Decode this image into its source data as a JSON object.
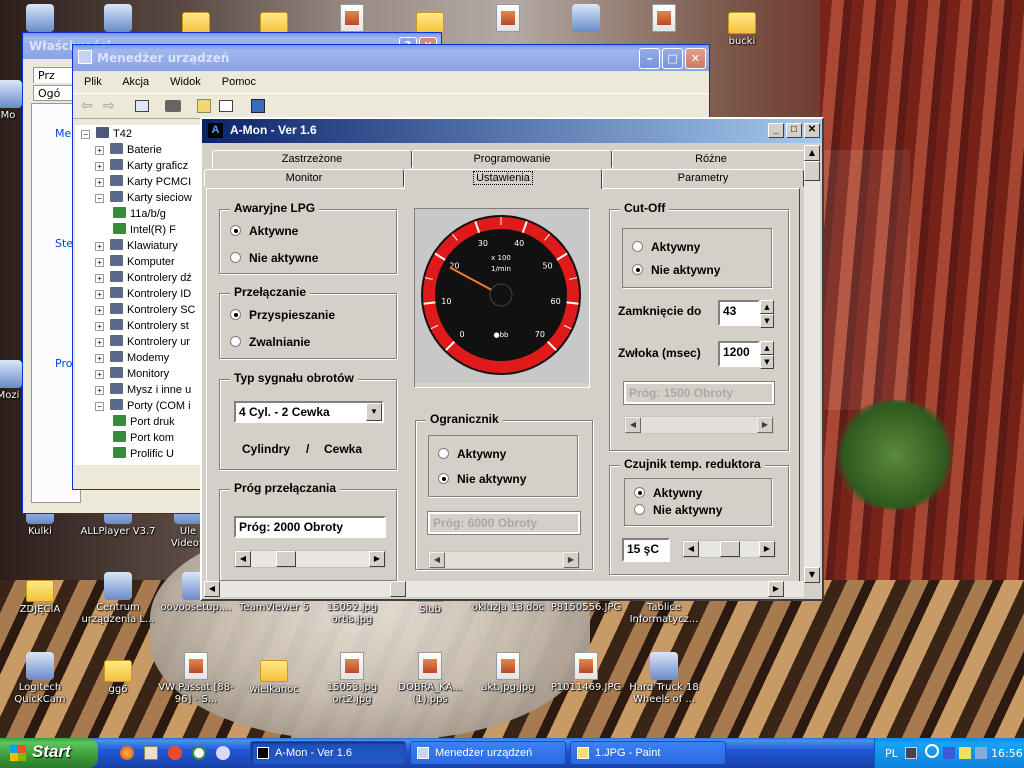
{
  "desktop": {
    "icons": [
      {
        "label": "Mo",
        "kind": "computer"
      },
      {
        "label": "",
        "kind": "app"
      },
      {
        "label": "",
        "kind": "folder"
      },
      {
        "label": "",
        "kind": "folder"
      },
      {
        "label": "",
        "kind": "image"
      },
      {
        "label": "",
        "kind": "folder"
      },
      {
        "label": "",
        "kind": "image"
      },
      {
        "label": "",
        "kind": "app"
      },
      {
        "label": "",
        "kind": "image"
      },
      {
        "label": "bucki",
        "kind": "folder"
      },
      {
        "label": "Kulki",
        "kind": "app"
      },
      {
        "label": "ALLPlayer V3.7",
        "kind": "app"
      },
      {
        "label": "Ule\nVideoS",
        "kind": "app"
      },
      {
        "label": "ZDJĘCIA",
        "kind": "folder"
      },
      {
        "label": "Centrum urządzenia L...",
        "kind": "app"
      },
      {
        "label": "oovoosetup....",
        "kind": "app"
      },
      {
        "label": "TeamViewer 5",
        "kind": "app"
      },
      {
        "label": "15052.jpg ortis.jpg",
        "kind": "image"
      },
      {
        "label": "Slub",
        "kind": "folder"
      },
      {
        "label": "okluzja 13.doc",
        "kind": "doc"
      },
      {
        "label": "P8150556.JPG",
        "kind": "image"
      },
      {
        "label": "Tablice Informatycz...",
        "kind": "app"
      },
      {
        "label": "Logitech QuickCam",
        "kind": "app"
      },
      {
        "label": "gg6",
        "kind": "folder"
      },
      {
        "label": "VW Passat [88-96] - S...",
        "kind": "pdf"
      },
      {
        "label": "wielkanoc",
        "kind": "folder"
      },
      {
        "label": "15053.jpg ort2.jpg",
        "kind": "image"
      },
      {
        "label": "DOBRA_KA... (1).pps",
        "kind": "pps"
      },
      {
        "label": "akt.jpg.jpg",
        "kind": "image"
      },
      {
        "label": "P1011469.JPG",
        "kind": "image"
      },
      {
        "label": "Hard Truck 18 Wheels of ...",
        "kind": "app"
      },
      {
        "label": "Mo",
        "kind": "app"
      },
      {
        "label": "Mozi",
        "kind": "app"
      }
    ]
  },
  "props_window": {
    "title": "Właściwości",
    "tab1": "Prz",
    "tab2": "Ogó",
    "labels": [
      "Me",
      "Ste",
      "Pro"
    ]
  },
  "device_manager": {
    "title": "Menedżer urządzeń",
    "menu": [
      "Plik",
      "Akcja",
      "Widok",
      "Pomoc"
    ],
    "root": "T42",
    "items": [
      {
        "label": "Baterie",
        "expanded": false,
        "indent": 1
      },
      {
        "label": "Karty graficz",
        "expanded": false,
        "indent": 1
      },
      {
        "label": "Karty PCMCI",
        "expanded": false,
        "indent": 1
      },
      {
        "label": "Karty sieciow",
        "expanded": true,
        "indent": 1
      },
      {
        "label": "11a/b/g",
        "expanded": null,
        "indent": 2
      },
      {
        "label": "Intel(R) F",
        "expanded": null,
        "indent": 2
      },
      {
        "label": "Klawiatury",
        "expanded": false,
        "indent": 1
      },
      {
        "label": "Komputer",
        "expanded": false,
        "indent": 1
      },
      {
        "label": "Kontrolery dź",
        "expanded": false,
        "indent": 1
      },
      {
        "label": "Kontrolery ID",
        "expanded": false,
        "indent": 1
      },
      {
        "label": "Kontrolery SC",
        "expanded": false,
        "indent": 1
      },
      {
        "label": "Kontrolery st",
        "expanded": false,
        "indent": 1
      },
      {
        "label": "Kontrolery ur",
        "expanded": false,
        "indent": 1
      },
      {
        "label": "Modemy",
        "expanded": false,
        "indent": 1
      },
      {
        "label": "Monitory",
        "expanded": false,
        "indent": 1
      },
      {
        "label": "Mysz i inne u",
        "expanded": false,
        "indent": 1
      },
      {
        "label": "Porty (COM i",
        "expanded": true,
        "indent": 1
      },
      {
        "label": "Port druk",
        "expanded": null,
        "indent": 2
      },
      {
        "label": "Port kom",
        "expanded": null,
        "indent": 2
      },
      {
        "label": "Prolific U",
        "expanded": null,
        "indent": 2
      }
    ]
  },
  "amon": {
    "title": "A-Mon - Ver 1.6",
    "tabs_row1": [
      "Zastrzeżone",
      "Programowanie",
      "Różne"
    ],
    "tabs_row2": [
      "Monitor",
      "Ustawienia",
      "Parametry"
    ],
    "active_tab": "Ustawienia",
    "awaryjne": {
      "title": "Awaryjne LPG",
      "opt1": "Aktywne",
      "opt2": "Nie aktywne",
      "selected": 1
    },
    "przelaczanie": {
      "title": "Przełączanie",
      "opt1": "Przyspieszanie",
      "opt2": "Zwalnianie",
      "selected": 1
    },
    "typ": {
      "title": "Typ sygnału obrotów",
      "value": "4 Cyl.  -   2 Cewka",
      "cyl_label": "Cylindry",
      "slash": "/",
      "cewka_label": "Cewka"
    },
    "prog": {
      "title": "Próg przełączania",
      "value": "Próg: 2000 Obroty",
      "slider": 0.25
    },
    "gauge": {
      "unit_top": "x 100",
      "unit_bottom": "1/min",
      "ticks": [
        "0",
        "10",
        "20",
        "30",
        "40",
        "50",
        "60",
        "70"
      ],
      "needle": 19,
      "logo": "●bb"
    },
    "ogranicznik": {
      "title": "Ogranicznik",
      "opt1": "Aktywny",
      "opt2": "Nie aktywny",
      "selected": 2,
      "value": "Próg: 6000 Obroty"
    },
    "cutoff": {
      "title": "Cut-Off",
      "opt1": "Aktywny",
      "opt2": "Nie aktywny",
      "selected": 2,
      "zamk_label": "Zamknięcie do",
      "zamk_value": "43",
      "zwloka_label": "Zwłoka (msec)",
      "zwloka_value": "1200",
      "prog_value": "Próg: 1500 Obroty"
    },
    "czujnik": {
      "title": "Czujnik temp. reduktora",
      "opt1": "Aktywny",
      "opt2": "Nie aktywny",
      "selected": 1,
      "value": "15 şC",
      "slider": 0.5
    }
  },
  "taskbar": {
    "start": "Start",
    "tasks": [
      "A-Mon - Ver 1.6",
      "Menedżer urządzeń",
      "1.JPG - Paint"
    ],
    "lang": "PL",
    "clock": "16:56"
  }
}
